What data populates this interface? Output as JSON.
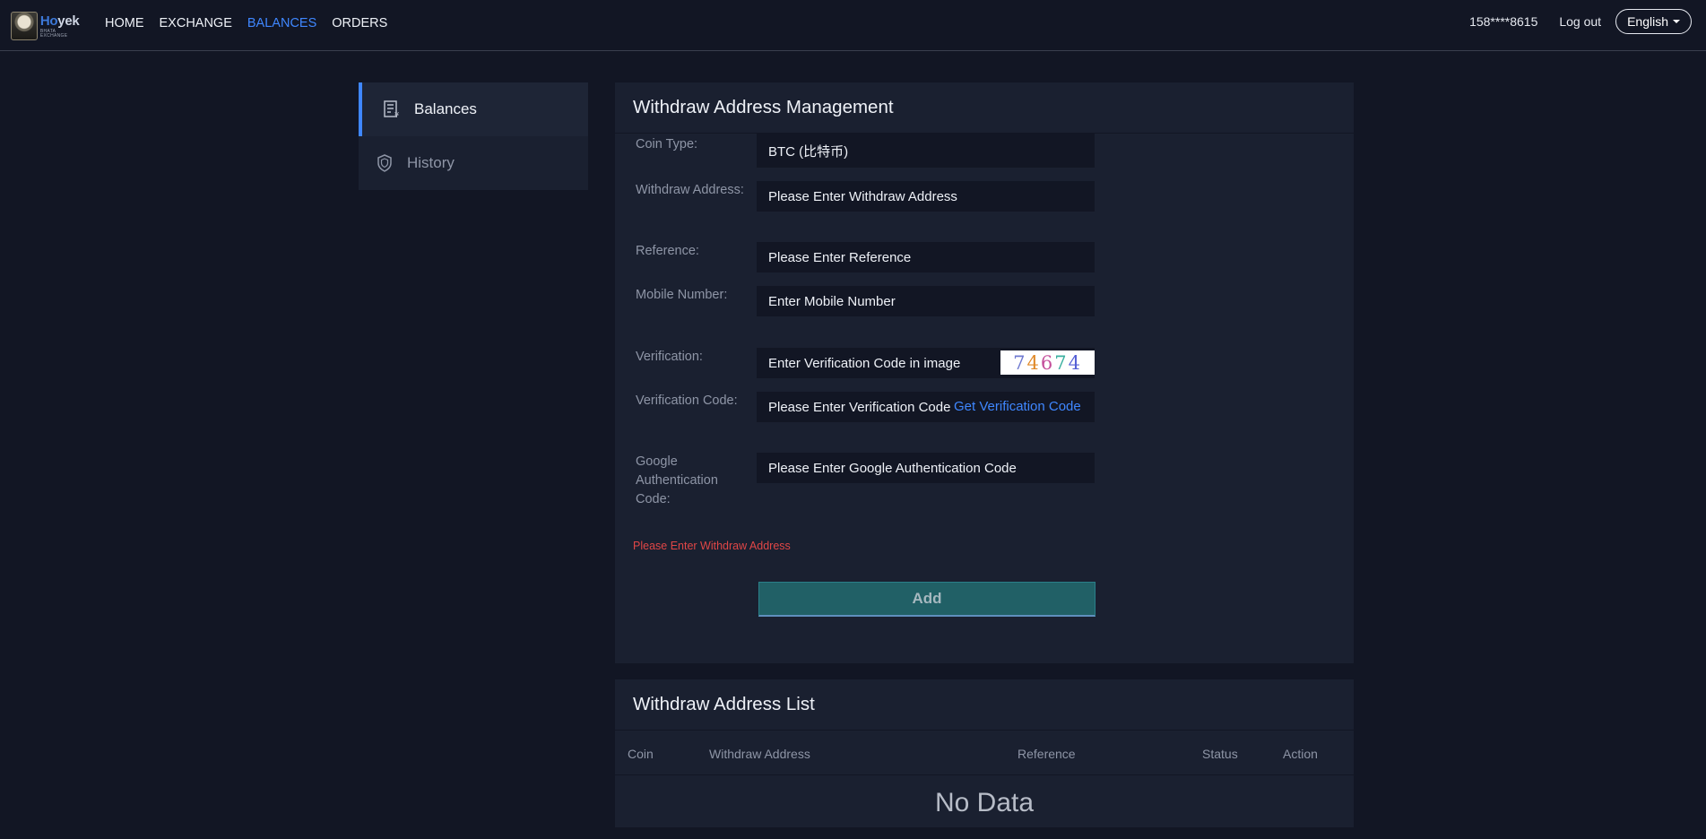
{
  "header": {
    "logo": {
      "name_part1": "Ho",
      "name_part2": "yek",
      "subtitle": "BHATA EXCHANGE"
    },
    "nav": [
      {
        "label": "HOME",
        "active": false
      },
      {
        "label": "EXCHANGE",
        "active": false
      },
      {
        "label": "BALANCES",
        "active": true
      },
      {
        "label": "ORDERS",
        "active": false
      }
    ],
    "user_phone": "158****8615",
    "logout_label": "Log out",
    "language": "English"
  },
  "sidebar": {
    "items": [
      {
        "label": "Balances",
        "icon": "ledger-icon",
        "active": true
      },
      {
        "label": "History",
        "icon": "shield-icon",
        "active": false
      }
    ]
  },
  "withdraw_form": {
    "title": "Withdraw Address Management",
    "coin_type": {
      "label": "Coin Type:",
      "value": "BTC (比特币)"
    },
    "withdraw_address": {
      "label": "Withdraw Address:",
      "placeholder": "Please Enter Withdraw Address"
    },
    "reference": {
      "label": "Reference:",
      "placeholder": "Please Enter Reference"
    },
    "mobile_number": {
      "label": "Mobile Number:",
      "placeholder": "Enter Mobile Number"
    },
    "verification": {
      "label": "Verification:",
      "placeholder": "Enter Verification Code in image",
      "captcha_text": "74674"
    },
    "verification_code": {
      "label": "Verification Code:",
      "placeholder": "Please Enter Verification Code",
      "get_code_label": "Get Verification Code"
    },
    "google_auth": {
      "label": "Google Authentication Code:",
      "placeholder": "Please Enter Google Authentication Code"
    },
    "error_message": "Please Enter Withdraw Address",
    "add_button": "Add"
  },
  "address_list": {
    "title": "Withdraw Address List",
    "columns": [
      "Coin",
      "Withdraw Address",
      "Reference",
      "Status",
      "Action"
    ],
    "empty_text": "No Data"
  },
  "colors": {
    "background": "#121624",
    "panel": "#1a2030",
    "accent": "#3f87ff",
    "error": "#e04646",
    "button": "#216066"
  }
}
